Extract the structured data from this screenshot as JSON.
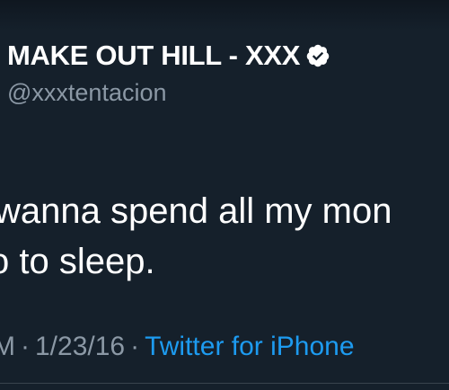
{
  "tweet": {
    "display_name": "MAKE OUT HILL - XXX",
    "handle": "@xxxtentacion",
    "verified": true,
    "text_lines": [
      "wanna spend all my mon",
      "o to sleep."
    ],
    "time_fragment": "M",
    "date": "1/23/16",
    "separator": "·",
    "source": "Twitter for iPhone"
  },
  "icons": {
    "verified": "verified-badge-icon"
  },
  "colors": {
    "background": "#15202b",
    "primary_text": "#ffffff",
    "secondary_text": "#8b98a5",
    "link": "#1d9bf0"
  }
}
